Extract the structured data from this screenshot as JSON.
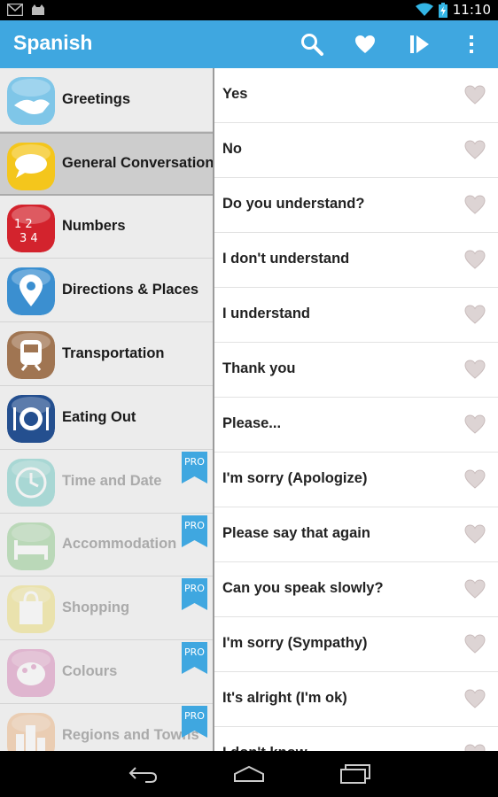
{
  "status": {
    "time": "11:10"
  },
  "appbar": {
    "title": "Spanish",
    "accent": "#3fa7e0",
    "actions": [
      "search-icon",
      "heart-icon",
      "play-icon",
      "overflow-menu-icon"
    ]
  },
  "categories": [
    {
      "label": "Greetings",
      "icon": "handshake-icon",
      "color": "#7fc6e8",
      "selected": false,
      "pro": false
    },
    {
      "label": "General Conversation",
      "icon": "speech-bubble-icon",
      "color": "#f4c61c",
      "selected": true,
      "pro": false
    },
    {
      "label": "Numbers",
      "icon": "numbers-icon",
      "color": "#d3232d",
      "selected": false,
      "pro": false
    },
    {
      "label": "Directions & Places",
      "icon": "map-pin-icon",
      "color": "#3b8fd0",
      "selected": false,
      "pro": false
    },
    {
      "label": "Transportation",
      "icon": "train-icon",
      "color": "#a07552",
      "selected": false,
      "pro": false
    },
    {
      "label": "Eating Out",
      "icon": "plate-icon",
      "color": "#244f8f",
      "selected": false,
      "pro": false
    },
    {
      "label": "Time and Date",
      "icon": "clock-icon",
      "color": "#2bb3a8",
      "selected": false,
      "pro": true
    },
    {
      "label": "Accommodation",
      "icon": "bed-icon",
      "color": "#5fb45a",
      "selected": false,
      "pro": true
    },
    {
      "label": "Shopping",
      "icon": "shopping-bag-icon",
      "color": "#e7d23a",
      "selected": false,
      "pro": true
    },
    {
      "label": "Colours",
      "icon": "palette-icon",
      "color": "#c9529a",
      "selected": false,
      "pro": true
    },
    {
      "label": "Regions and Towns",
      "icon": "city-icon",
      "color": "#e8964a",
      "selected": false,
      "pro": true
    }
  ],
  "pro_label": "PRO",
  "phrases": [
    "Yes",
    "No",
    "Do you understand?",
    "I don't understand",
    "I understand",
    "Thank you",
    "Please...",
    "I'm sorry (Apologize)",
    "Please say that again",
    "Can you speak slowly?",
    "I'm sorry (Sympathy)",
    "It's alright (I'm ok)",
    "I don't know"
  ],
  "nav": [
    "back-icon",
    "home-icon",
    "recents-icon"
  ]
}
